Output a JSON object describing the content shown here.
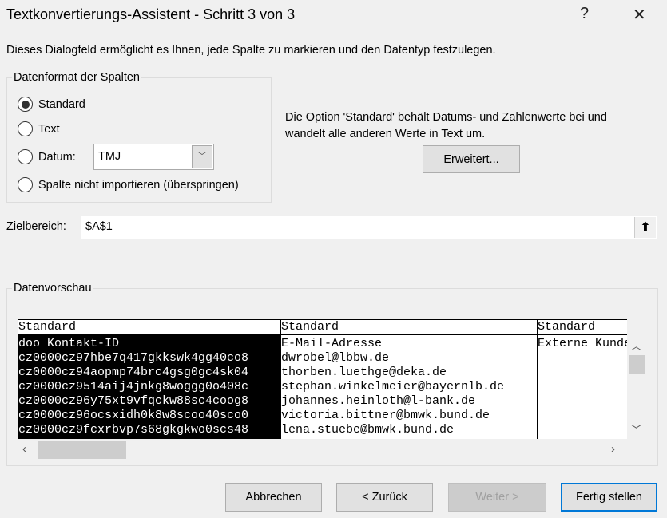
{
  "title": "Textkonvertierungs-Assistent - Schritt 3 von 3",
  "help_label": "?",
  "close_label": "✕",
  "description": "Dieses Dialogfeld ermöglicht es Ihnen, jede Spalte zu markieren und den Datentyp festzulegen.",
  "format_group": {
    "legend": "Datenformat der Spalten",
    "options": [
      {
        "label": "Standard",
        "selected": true
      },
      {
        "label": "Text",
        "selected": false
      },
      {
        "label": "Datum:",
        "selected": false
      },
      {
        "label": "Spalte nicht importieren (überspringen)",
        "selected": false
      }
    ],
    "date_format": "TMJ"
  },
  "info_text": [
    "Die Option 'Standard' behält Datums- und Zahlenwerte bei und",
    "wandelt alle anderen Werte in Text um."
  ],
  "advanced_label": "Erweitert...",
  "target": {
    "label": "Zielbereich:",
    "value": "$A$1"
  },
  "preview": {
    "legend": "Datenvorschau",
    "columns": [
      {
        "header": "Standard",
        "rows": [
          "doo Kontakt-ID",
          "cz0000cz97hbe7q417gkkswk4gg40co8",
          "cz0000cz94aopmp74brc4gsg0gc4sk04",
          "cz0000cz9514aij4jnkg8woggg0o408c",
          "cz0000cz96y75xt9vfqckw88sc4coog8",
          "cz0000cz96ocsxidh0k8w8scoo40sco0",
          "cz0000cz9fcxrbvp7s68gkgkwo0scs48"
        ]
      },
      {
        "header": "Standard",
        "rows": [
          "E-Mail-Adresse",
          "dwrobel@lbbw.de",
          "thorben.luethge@deka.de",
          "stephan.winkelmeier@bayernlb.de",
          "johannes.heinloth@l-bank.de",
          "victoria.bittner@bmwk.bund.de",
          "lena.stuebe@bmwk.bund.de"
        ]
      },
      {
        "header": "Standard",
        "rows": [
          "Externe Kunde"
        ]
      }
    ]
  },
  "buttons": {
    "cancel": "Abbrechen",
    "back": "< Zurück",
    "next": "Weiter >",
    "finish": "Fertig stellen"
  }
}
